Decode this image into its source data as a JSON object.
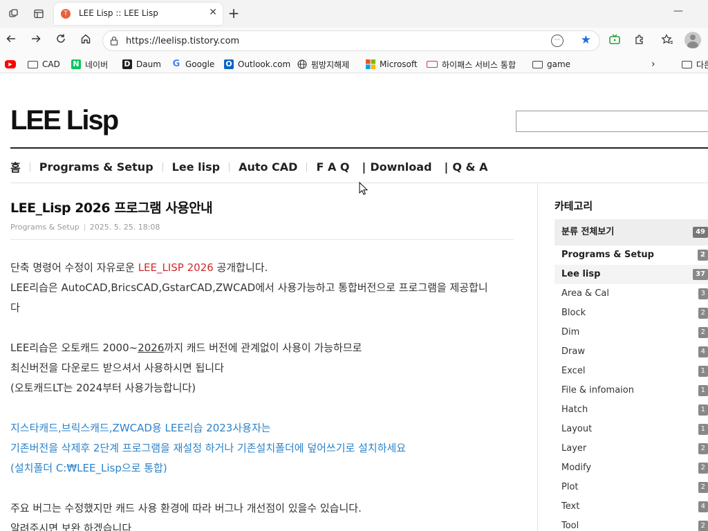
{
  "browser": {
    "tab_title": "LEE Lisp :: LEE Lisp",
    "tab_close": "✕",
    "new_tab": "+",
    "minimize": "—",
    "url": "https://leelisp.tistory.com",
    "bookmarks": [
      {
        "label": "",
        "icon": "youtube-icon"
      },
      {
        "label": "CAD",
        "icon": "folder-icon"
      },
      {
        "label": "네이버",
        "icon": "naver-icon",
        "glyph": "N"
      },
      {
        "label": "Daum",
        "icon": "daum-icon",
        "glyph": "D"
      },
      {
        "label": "Google",
        "icon": "google-icon",
        "glyph": "G"
      },
      {
        "label": "Outlook.com",
        "icon": "outlook-icon",
        "glyph": "O"
      },
      {
        "label": "펌방지해제",
        "icon": "globe-icon"
      },
      {
        "label": "Microsoft",
        "icon": "microsoft-icon"
      },
      {
        "label": "하이패스 서비스 통합",
        "icon": "hipass-icon"
      },
      {
        "label": "game",
        "icon": "folder-icon"
      },
      {
        "label": "다른",
        "icon": "folder-icon"
      }
    ],
    "colors": {
      "accent": "#1a6fd8",
      "youtube": "#ff0000",
      "naver": "#03c75a",
      "daum": "#1e1e1e",
      "outlook": "#0a64c8"
    }
  },
  "blog": {
    "title": "LEE Lisp",
    "menu": {
      "home": "홈",
      "programs": "Programs & Setup",
      "leelisp": "Lee lisp",
      "autocad": "Auto CAD",
      "faq": "F A Q",
      "download": "Download",
      "qa": "Q & A",
      "bar": "|"
    }
  },
  "post": {
    "title": "LEE_Lisp 2026 프로그램 사용안내",
    "category": "Programs & Setup",
    "date": "2025. 5. 25. 18:08",
    "p1_a": "단축 명령어 수정이 자유로운 ",
    "p1_red": "LEE_LISP 2026",
    "p1_b": " 공개합니다.",
    "p2_line1": "LEE리습은 AutoCAD,BricsCAD,GstarCAD,ZWCAD에서 사용가능하고 통합버전으로 프로그램을 제공합니",
    "p2_line2": "다",
    "p3_a": "LEE리습은 오토캐드 2000~",
    "p3_ul": "2026",
    "p3_b": "까지 캐드 버전에 관계없이 사용이 가능하므로",
    "p4": "최신버전을 다운로드 받으셔서 사용하시면 됩니다",
    "p5": "(오토캐드LT는 2024부터 사용가능합니다)",
    "b1": "지스타캐드,브릭스캐드,ZWCAD용 LEE리습 2023사용자는",
    "b2": "기존버전을 삭제후 2단계 프로그램을 재설정 하거나 기존설치폴더에 덮어쓰기로 설치하세요",
    "b3": "(설치폴더 C:₩LEE_Lisp으로 통합)",
    "p6": "주요 버그는 수정했지만 캐드 사용 환경에 따라 버그나 개선점이 있을수 있습니다.",
    "p7": "알려주시면 보완 하겠습니다"
  },
  "sidebar": {
    "heading": "카테고리",
    "categories": [
      {
        "label": "분류 전체보기",
        "count": "49"
      },
      {
        "label": "Programs & Setup",
        "count": "2"
      },
      {
        "label": "Lee lisp",
        "count": "37"
      },
      {
        "label": "Area & Cal",
        "count": "3"
      },
      {
        "label": "Block",
        "count": "2"
      },
      {
        "label": "Dim",
        "count": "2"
      },
      {
        "label": "Draw",
        "count": "4"
      },
      {
        "label": "Excel",
        "count": "1"
      },
      {
        "label": "File & infomaion",
        "count": "1"
      },
      {
        "label": "Hatch",
        "count": "1"
      },
      {
        "label": "Layout",
        "count": "1"
      },
      {
        "label": "Layer",
        "count": "2"
      },
      {
        "label": "Modify",
        "count": "2"
      },
      {
        "label": "Plot",
        "count": "2"
      },
      {
        "label": "Text",
        "count": "4"
      },
      {
        "label": "Tool",
        "count": "2"
      }
    ]
  }
}
